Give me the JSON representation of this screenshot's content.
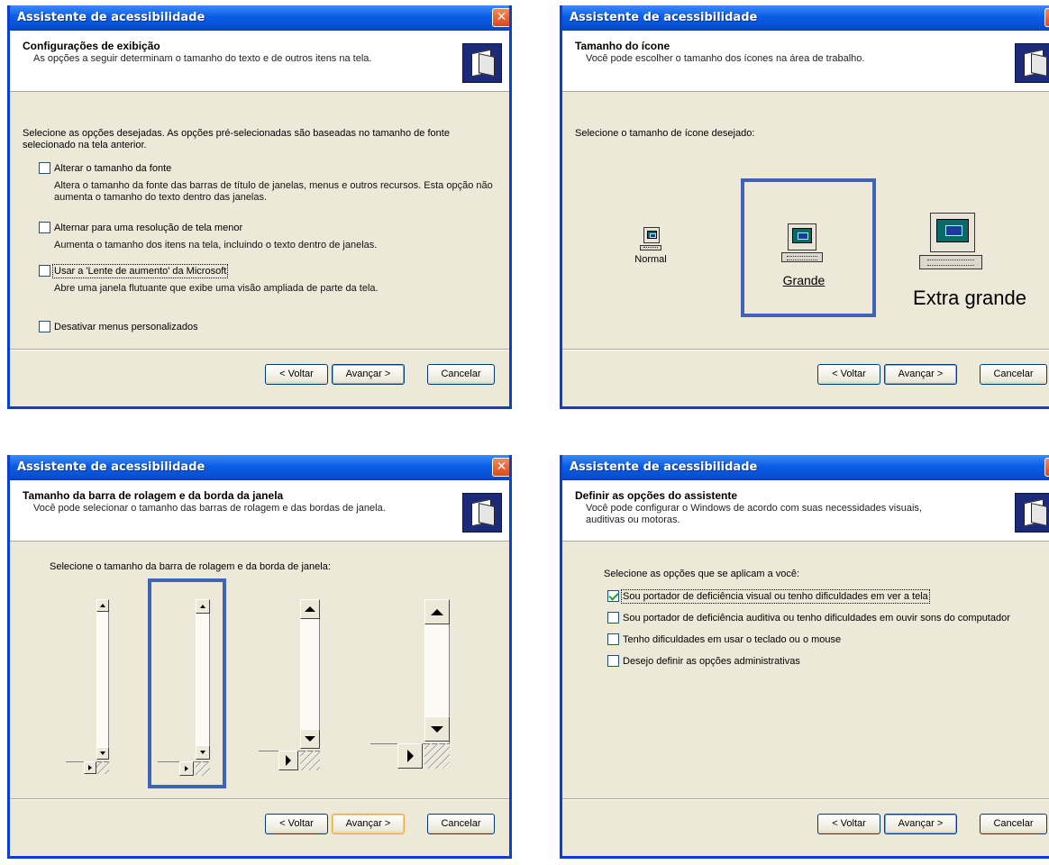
{
  "dialogs": {
    "display": {
      "title": "Assistente de acessibilidade",
      "close": "✕",
      "header_title": "Configurações de exibição",
      "header_sub": "As opções a seguir determinam o tamanho do texto e de outros itens na tela.",
      "intro": "Selecione as opções desejadas. As opções pré-selecionadas são baseadas no tamanho de fonte selecionado na tela anterior.",
      "options": [
        {
          "label": "Alterar o tamanho da fonte",
          "desc": "Altera o tamanho da fonte das barras de título de janelas, menus e outros recursos. Esta opção não aumenta o tamanho do texto dentro das janelas.",
          "checked": false
        },
        {
          "label": "Alternar para uma resolução de tela menor",
          "desc": "Aumenta o tamanho dos itens na tela, incluindo o texto dentro de janelas.",
          "checked": false
        },
        {
          "label": "Usar a 'Lente de aumento' da Microsoft",
          "desc": "Abre uma janela flutuante que exibe uma visão ampliada de parte da tela.",
          "checked": false
        },
        {
          "label": "Desativar menus personalizados",
          "desc": "",
          "checked": false
        }
      ],
      "btn_back": "< Voltar",
      "btn_next": "Avançar >",
      "btn_cancel": "Cancelar"
    },
    "icon_size": {
      "title": "Assistente de acessibilidade",
      "close": "✕",
      "header_title": "Tamanho do ícone",
      "header_sub": "Você pode escolher o tamanho dos ícones na área de trabalho.",
      "intro": "Selecione o tamanho de ícone desejado:",
      "sizes": [
        "Normal",
        "Grande",
        "Extra grande"
      ],
      "selected": "Grande",
      "btn_back": "< Voltar",
      "btn_next": "Avançar >",
      "btn_cancel": "Cancelar"
    },
    "scrollbar": {
      "title": "Assistente de acessibilidade",
      "close": "✕",
      "header_title": "Tamanho da barra de rolagem e da borda da janela",
      "header_sub": "Você pode selecionar o tamanho das barras de rolagem e das bordas de janela.",
      "intro": "Selecione o tamanho da barra de rolagem e da borda de janela:",
      "selected_index": 1,
      "btn_back": "< Voltar",
      "btn_next": "Avançar >",
      "btn_cancel": "Cancelar"
    },
    "wizard_options": {
      "title": "Assistente de acessibilidade",
      "close": "✕",
      "header_title": "Definir as opções do assistente",
      "header_sub": "Você pode configurar o Windows de acordo com suas necessidades visuais, auditivas ou motoras.",
      "intro": "Selecione as opções que se aplicam a você:",
      "options": [
        {
          "label": "Sou portador de deficiência visual ou tenho dificuldades em ver a tela",
          "checked": true
        },
        {
          "label": "Sou portador de deficiência auditiva ou tenho dificuldades em ouvir sons do computador",
          "checked": false
        },
        {
          "label": "Tenho dificuldades em usar o teclado ou o mouse",
          "checked": false
        },
        {
          "label": "Desejo definir as opções administrativas",
          "checked": false
        }
      ],
      "btn_back": "< Voltar",
      "btn_next": "Avançar >",
      "btn_cancel": "Cancelar"
    }
  },
  "colors": {
    "titlebar": "#0a5ce8",
    "dialog_bg": "#ece9d8",
    "selection": "#3f63b8",
    "close": "#d8491c"
  }
}
